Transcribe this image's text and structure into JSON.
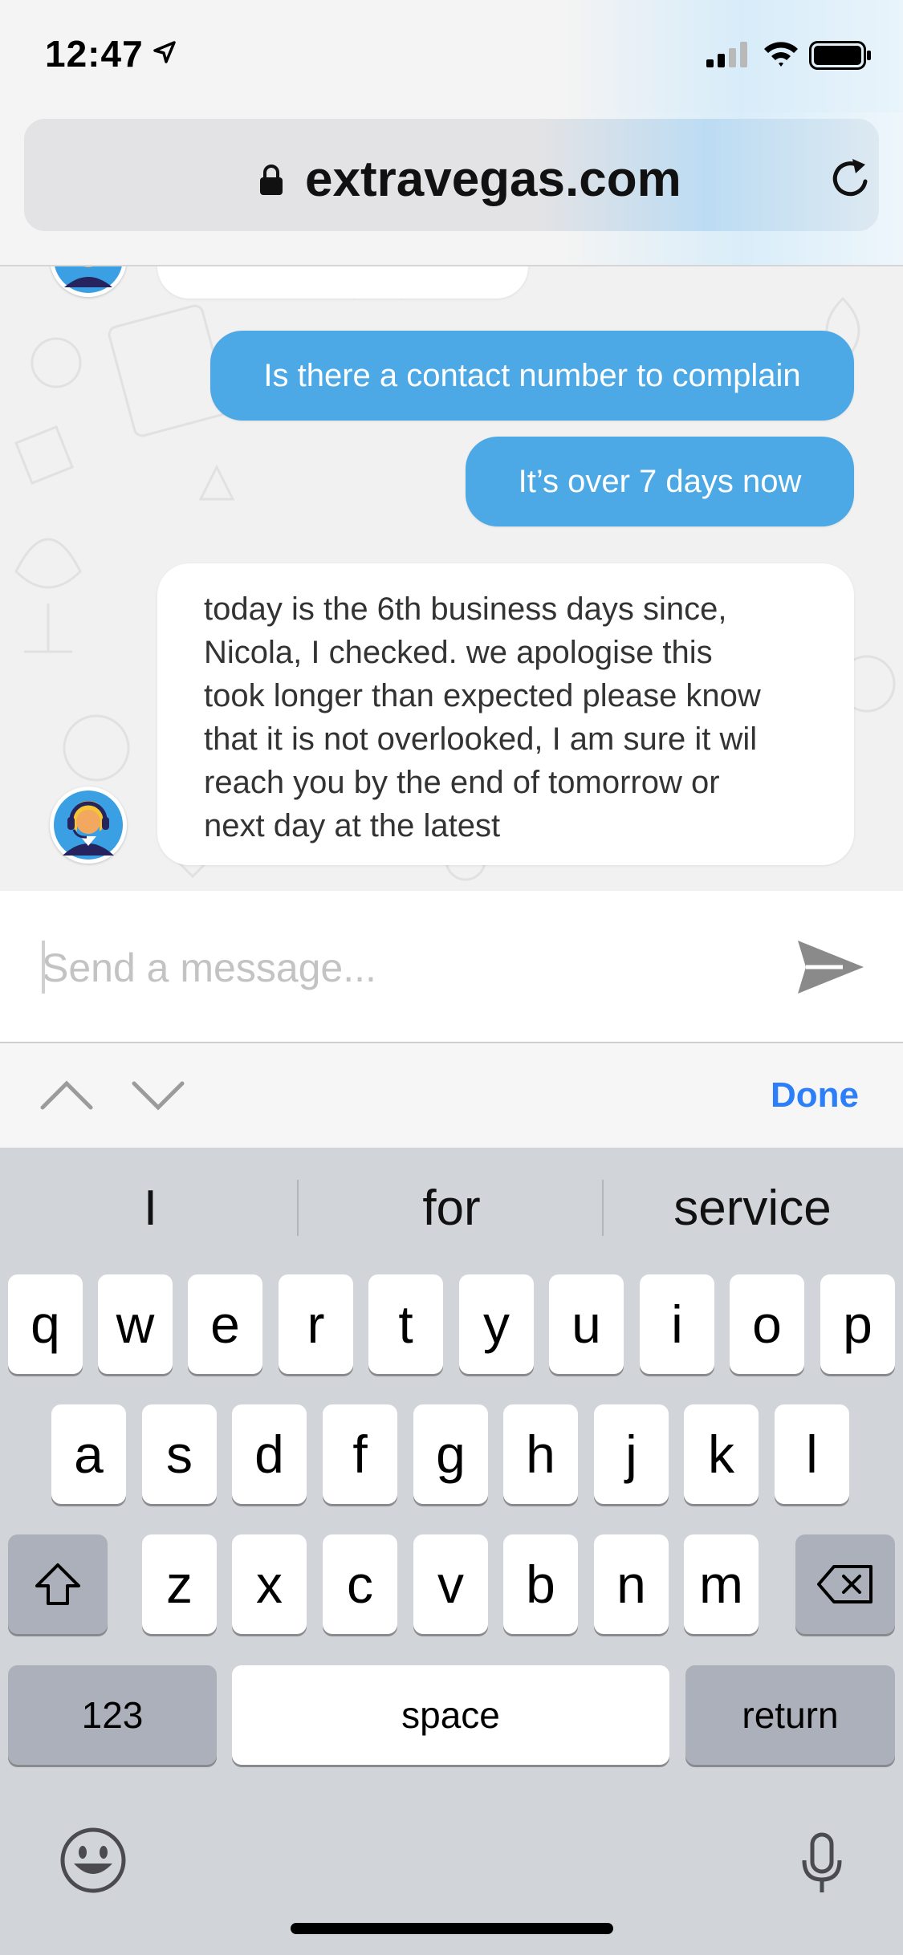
{
  "status_bar": {
    "time": "12:47",
    "icons": [
      "location-arrow-icon",
      "cellular-signal-icon",
      "wifi-icon",
      "battery-icon"
    ]
  },
  "browser": {
    "url": "extravegas.com",
    "icons": [
      "lock-icon",
      "reload-icon"
    ]
  },
  "chat": {
    "messages": [
      {
        "from": "user",
        "text": "Is there a contact number to complain"
      },
      {
        "from": "user",
        "text": "It’s over 7 days now"
      },
      {
        "from": "agent",
        "text": "today is the 6th business days since, Nicola, I checked. we apologise this took longer than expected please know that it is not overlooked, I am sure it wil reach you by the end of tomorrow or next day at the latest"
      }
    ],
    "user_bubble_color": "#4da9e6",
    "agent_bubble_color": "#ffffff"
  },
  "composer": {
    "placeholder": "Send a message...",
    "value": ""
  },
  "accessory": {
    "done_label": "Done",
    "done_color": "#2d7ff9"
  },
  "keyboard": {
    "suggestions": [
      "I",
      "for",
      "service"
    ],
    "row1": [
      "q",
      "w",
      "e",
      "r",
      "t",
      "y",
      "u",
      "i",
      "o",
      "p"
    ],
    "row2": [
      "a",
      "s",
      "d",
      "f",
      "g",
      "h",
      "j",
      "k",
      "l"
    ],
    "row3": [
      "z",
      "x",
      "c",
      "v",
      "b",
      "n",
      "m"
    ],
    "numbers_label": "123",
    "space_label": "space",
    "return_label": "return"
  }
}
